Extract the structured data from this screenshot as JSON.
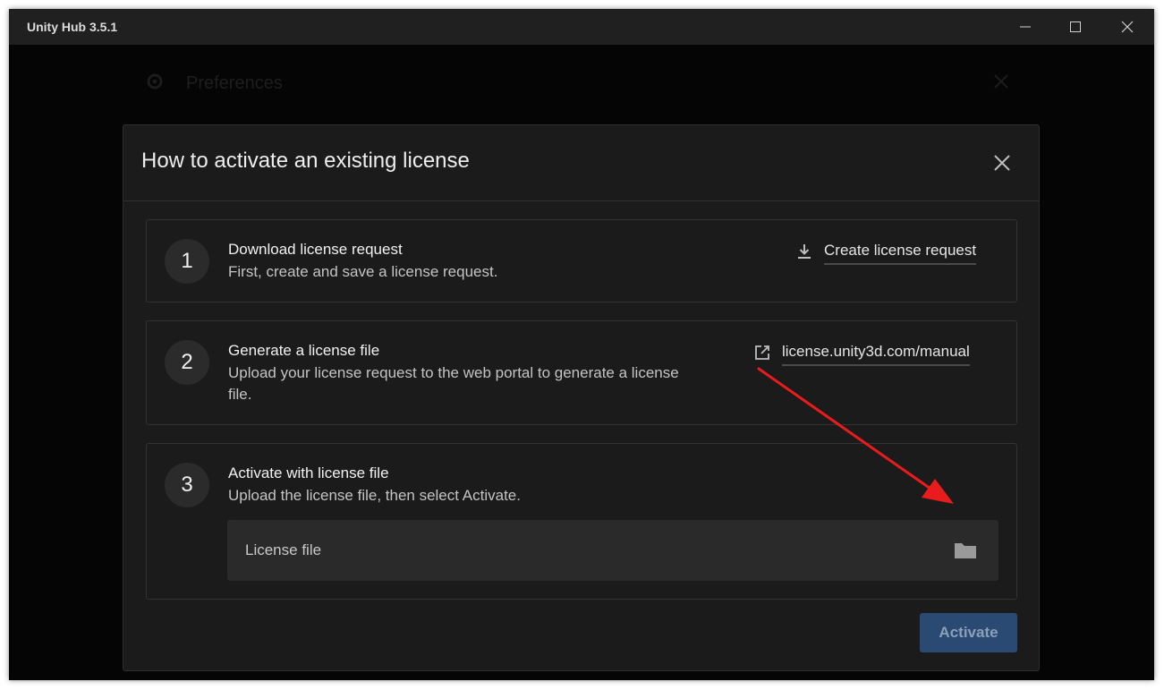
{
  "window": {
    "title": "Unity Hub 3.5.1",
    "controls": [
      "minimize-icon",
      "maximize-icon",
      "close-icon"
    ]
  },
  "background": {
    "preferences_title": "Preferences"
  },
  "dialog": {
    "title": "How to activate an existing license",
    "steps": [
      {
        "number": "1",
        "title": "Download license request",
        "description": "First, create and save a license request.",
        "action_label": "Create license request",
        "action_icon": "download-icon"
      },
      {
        "number": "2",
        "title": "Generate a license file",
        "description": "Upload your license request to the web portal to generate a license file.",
        "action_label": "license.unity3d.com/manual",
        "action_icon": "external-link-icon"
      },
      {
        "number": "3",
        "title": "Activate with license file",
        "description": "Upload the license file, then select Activate.",
        "file_field_placeholder": "License file",
        "file_field_icon": "folder-icon"
      }
    ],
    "activate_label": "Activate"
  },
  "colors": {
    "activate_bg": "#2a4a73",
    "annotation_arrow": "#e81c1c"
  }
}
